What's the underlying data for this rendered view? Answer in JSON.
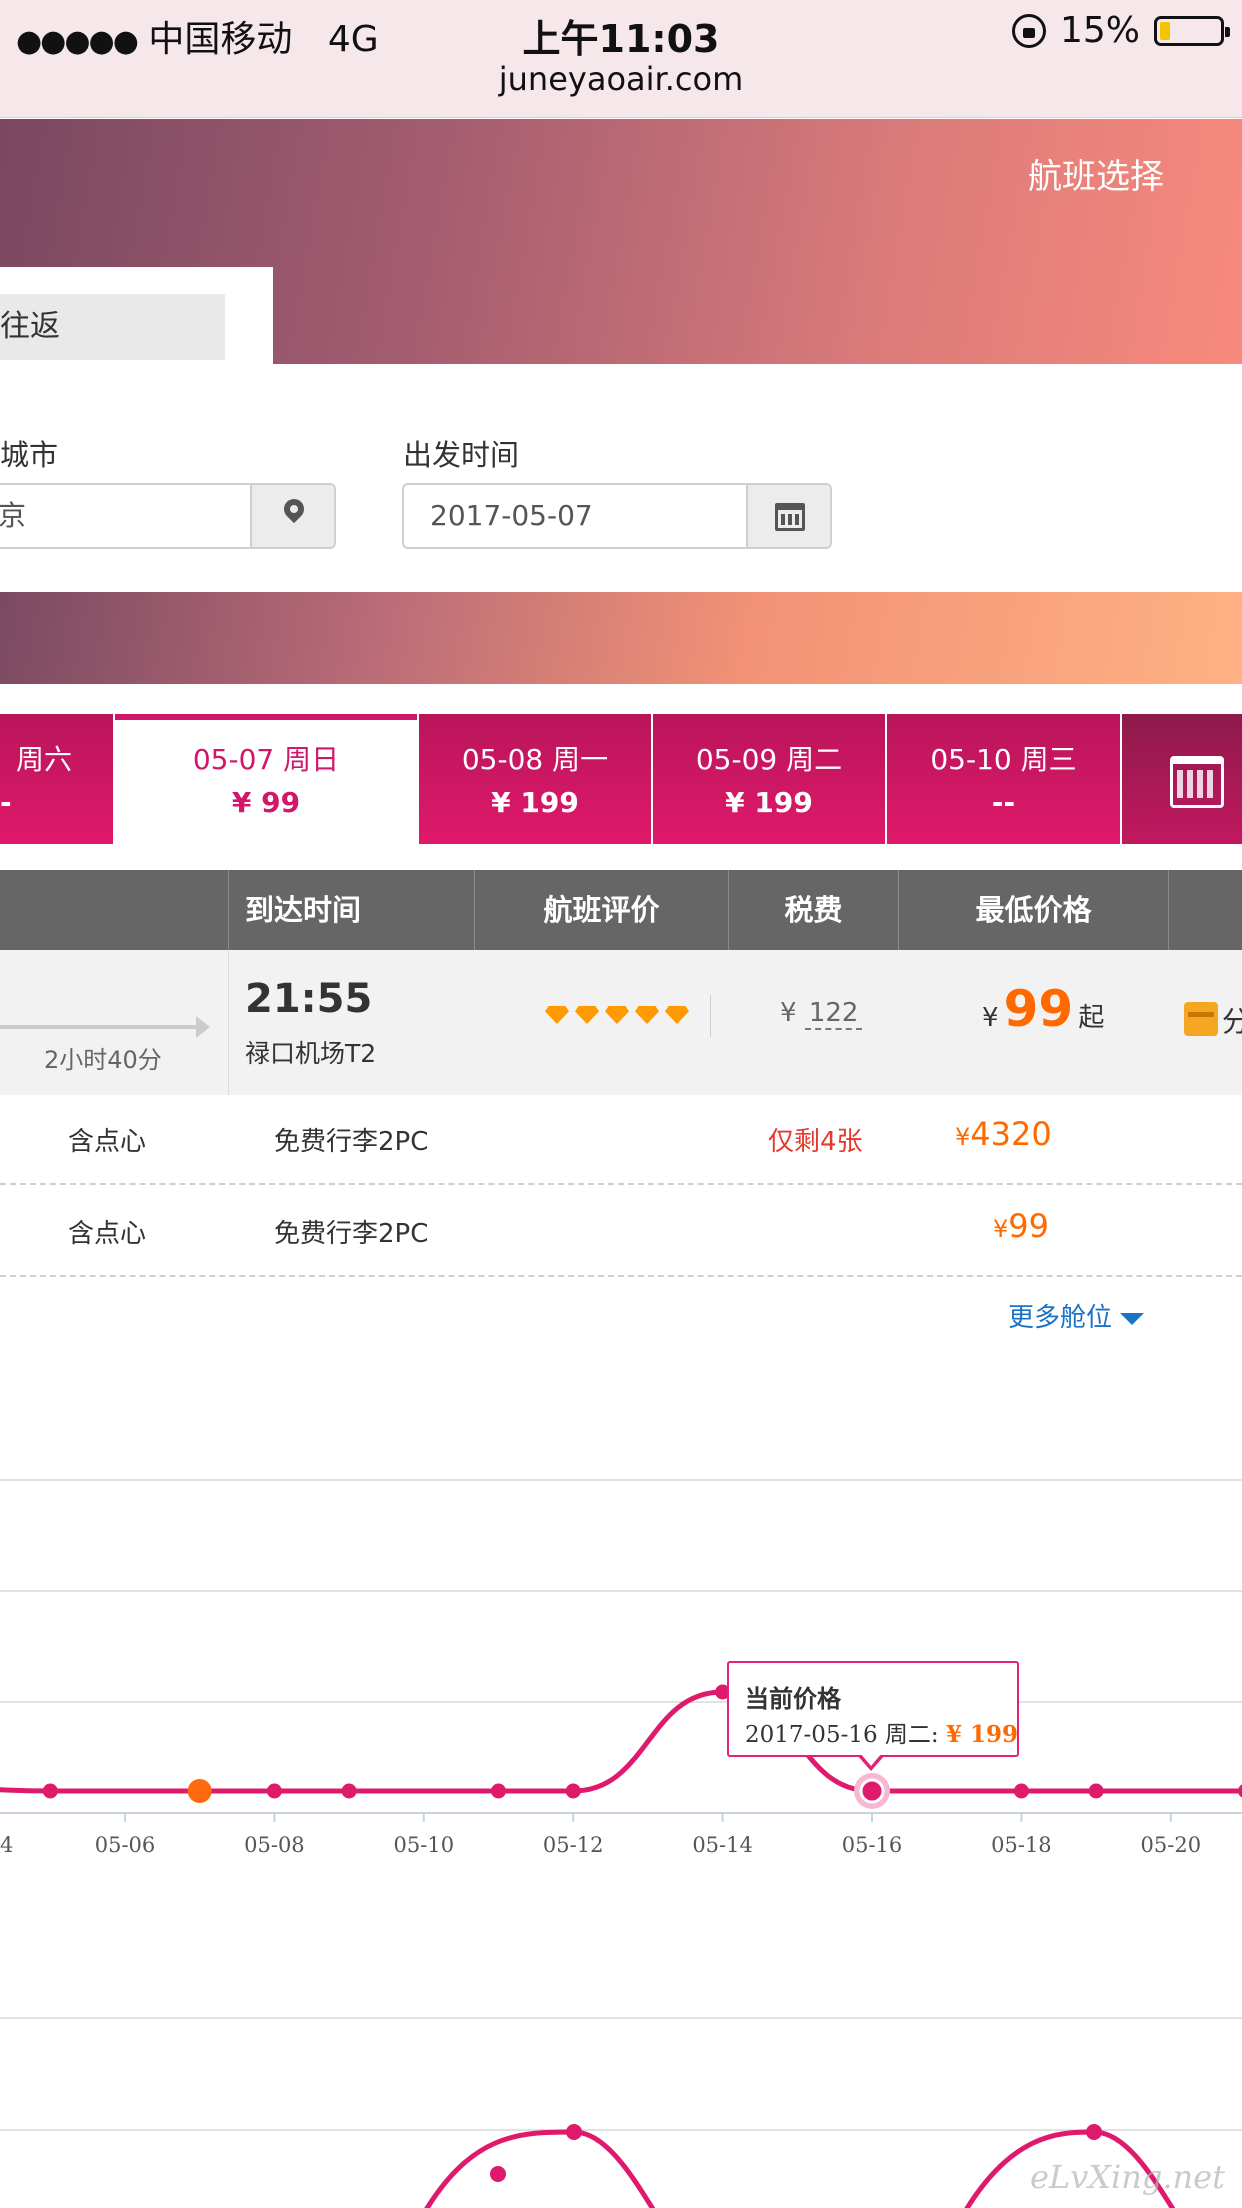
{
  "status_bar": {
    "signal": "●●●●●",
    "carrier": "中国移动",
    "network": "4G",
    "time": "上午11:03",
    "url": "juneyaoair.com",
    "battery": "15%"
  },
  "hero": {
    "title": "航班选择",
    "trip_tab": "往返"
  },
  "search": {
    "city_label": "城市",
    "city_value": "京",
    "date_label": "出发时间",
    "date_value": "2017-05-07"
  },
  "date_tabs": [
    {
      "date": "周六",
      "price": "-"
    },
    {
      "date": "05-07  周日",
      "price": "¥ 99"
    },
    {
      "date": "05-08  周一",
      "price": "¥ 199"
    },
    {
      "date": "05-09  周二",
      "price": "¥ 199"
    },
    {
      "date": "05-10  周三",
      "price": "--"
    }
  ],
  "table": {
    "headers": [
      "到达时间",
      "航班评价",
      "税费",
      "最低价格"
    ]
  },
  "flight": {
    "duration": "2小时40分",
    "arrival_time": "21:55",
    "arrival_airport": "禄口机场T2",
    "tax_symbol": "¥",
    "tax": "122",
    "price_symbol": "¥",
    "price": "99",
    "price_suffix": "起",
    "share_label": "分"
  },
  "cabins": [
    {
      "meal": "含点心",
      "baggage": "免费行李2PC",
      "remaining": "仅剩4张",
      "price_symbol": "¥",
      "price": "4320"
    },
    {
      "meal": "含点心",
      "baggage": "免费行李2PC",
      "remaining": "",
      "price_symbol": "¥",
      "price": "99"
    }
  ],
  "more_cabins": "更多舱位",
  "tooltip": {
    "title": "当前价格",
    "line": "2017-05-16 周二: ",
    "price": "¥ 199"
  },
  "watermark": "eLvXing.net",
  "colors": {
    "accent": "#d0176a",
    "price": "#ff6a00",
    "link": "#1a73c9"
  },
  "chart_data": {
    "type": "line",
    "x_ticks": [
      "4",
      "05-06",
      "05-08",
      "05-10",
      "05-12",
      "05-14",
      "05-16",
      "05-18",
      "05-20"
    ],
    "series": [
      {
        "points": [
          {
            "x": "05-05",
            "y": 99
          },
          {
            "x": "05-07",
            "y": 99
          },
          {
            "x": "05-08",
            "y": 99
          },
          {
            "x": "05-09",
            "y": 99
          },
          {
            "x": "05-11",
            "y": 99
          },
          {
            "x": "05-12",
            "y": 99
          },
          {
            "x": "05-14",
            "y": 199
          },
          {
            "x": "05-16",
            "y": 99
          },
          {
            "x": "05-18",
            "y": 99
          },
          {
            "x": "05-19",
            "y": 99
          },
          {
            "x": "05-21",
            "y": 99
          }
        ]
      }
    ],
    "highlight_selected": "05-07",
    "highlight_hover": "05-16",
    "grid": true
  }
}
